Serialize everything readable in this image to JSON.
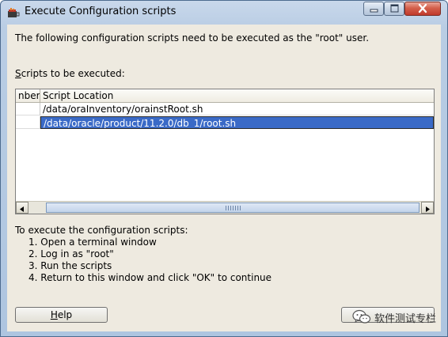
{
  "window": {
    "title": "Execute Configuration scripts",
    "icon": "java-cup-icon"
  },
  "intro_text": "The following configuration scripts need to be executed as the \"root\" user.",
  "scripts_label_mnemonic": "S",
  "scripts_label_rest": "cripts to be executed:",
  "table": {
    "columns": [
      "nber",
      "Script Location"
    ],
    "rows": [
      {
        "number": "",
        "location": "/data/oraInventory/orainstRoot.sh",
        "selected": false
      },
      {
        "number": "",
        "location": "/data/oracle/product/11.2.0/db_1/root.sh",
        "selected": true
      }
    ]
  },
  "instructions": {
    "title": "To execute the configuration scripts:",
    "steps": [
      "1. Open a terminal window",
      "2. Log in as \"root\"",
      "3. Run the scripts",
      "4. Return to this window and click \"OK\" to continue"
    ]
  },
  "buttons": {
    "help_mnemonic": "H",
    "help_rest": "elp",
    "ok": ""
  },
  "watermark": {
    "text": "软件测试专栏",
    "icon": "wechat-icon"
  },
  "colors": {
    "selection": "#3a6ac7",
    "dialog_bg": "#eeeae0",
    "titlebar": "#b9cde4"
  }
}
